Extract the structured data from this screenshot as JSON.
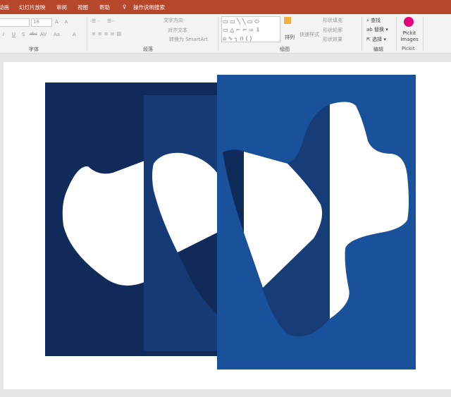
{
  "tabs": [
    "动画",
    "幻灯片放映",
    "审阅",
    "视图",
    "帮助",
    "操作说明搜索"
  ],
  "font": {
    "size": "18",
    "group_label": "字体",
    "buttons": [
      "A",
      "A",
      "I",
      "U",
      "S",
      "abc",
      "AV",
      "Aa",
      "A"
    ]
  },
  "paragraph": {
    "text_direction": "文字方向",
    "align_text": "对齐文本",
    "convert_smartart": "转换为 SmartArt",
    "group_label": "段落"
  },
  "drawing": {
    "arrange": "排列",
    "quick_styles": "快速样式",
    "shape_fill": "形状填充",
    "shape_outline": "形状轮廓",
    "shape_effects": "形状效果",
    "group_label": "绘图"
  },
  "editing": {
    "find": "查找",
    "replace": "替换",
    "select": "选择",
    "group_label": "编辑"
  },
  "pickit": {
    "button": "Pickit Images",
    "group_label": "Pickit",
    "brand_color": "#e5007e"
  },
  "colors": {
    "ribbon_tab": "#b7472a",
    "navy": "#102b5a",
    "panel": "#163a75",
    "blue": "#1a519b",
    "mid": "#173d78"
  }
}
